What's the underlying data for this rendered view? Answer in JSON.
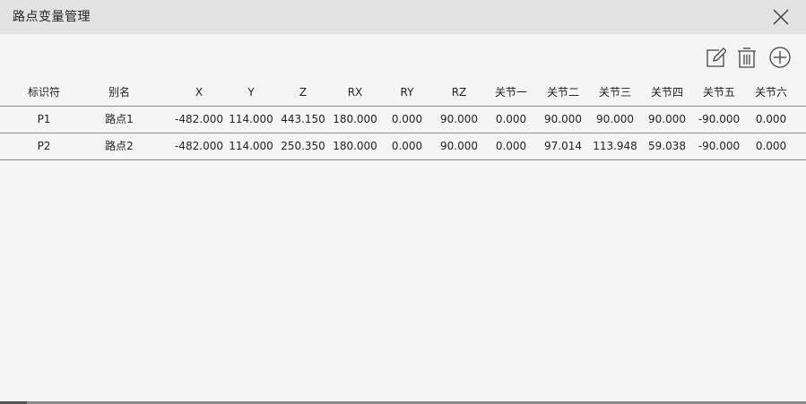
{
  "window": {
    "title": "路点变量管理"
  },
  "toolbar": {
    "edit_icon": "edit-icon",
    "delete_icon": "trash-icon",
    "add_icon": "plus-circle-icon"
  },
  "table": {
    "headers": [
      "标识符",
      "别名",
      "X",
      "Y",
      "Z",
      "RX",
      "RY",
      "RZ",
      "关节一",
      "关节二",
      "关节三",
      "关节四",
      "关节五",
      "关节六"
    ],
    "rows": [
      [
        "P1",
        "路点1",
        "-482.000",
        "114.000",
        "443.150",
        "180.000",
        "0.000",
        "90.000",
        "0.000",
        "90.000",
        "90.000",
        "90.000",
        "-90.000",
        "0.000"
      ],
      [
        "P2",
        "路点2",
        "-482.000",
        "114.000",
        "250.350",
        "180.000",
        "0.000",
        "90.000",
        "0.000",
        "97.014",
        "113.948",
        "59.038",
        "-90.000",
        "0.000"
      ]
    ]
  },
  "colors": {
    "titlebar_bg": "#e3e3e3",
    "body_bg": "#f5f5f5",
    "divider": "#8a8a8a",
    "icon_stroke": "#444444"
  }
}
